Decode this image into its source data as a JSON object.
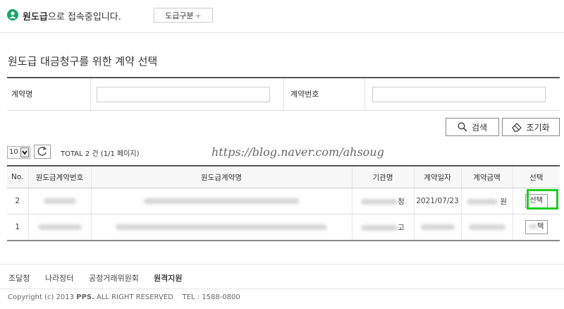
{
  "header": {
    "user_bold": "원도급",
    "status_suffix": "으로 접속중입니다.",
    "type_button": "도급구분",
    "type_button_icon": "plus-icon"
  },
  "page_title": "원도급 대금청구를 위한 계약 선택",
  "search": {
    "contract_name_label": "계약명",
    "contract_name_value": "",
    "contract_no_label": "계약번호",
    "contract_no_value": "",
    "search_button": "검색",
    "reset_button": "조기화"
  },
  "list_meta": {
    "page_size": "10",
    "total": "TOTAL 2 건 (1/1 페이지)"
  },
  "watermark": "https://blog.naver.com/ahsoug",
  "table": {
    "headers": [
      "No.",
      "원도급계약번호",
      "원도급계약명",
      "기관명",
      "계약일자",
      "계약금액",
      "선택"
    ],
    "rows": [
      {
        "no": "2",
        "agency_suffix": "청",
        "date": "2021/07/23",
        "amount_suffix": "원",
        "select": "선택"
      },
      {
        "no": "1",
        "agency_suffix": "고",
        "date": "",
        "amount_suffix": "",
        "select": "택"
      }
    ]
  },
  "footer": {
    "links": [
      "조달청",
      "나라장터",
      "공정거래위원회",
      "원격지원"
    ],
    "copyright_prefix": "Copyright (c) 2013 ",
    "copyright_brand": "PPS.",
    "copyright_suffix": " ALL RIGHT RESERVED    TEL : 1588-0800"
  },
  "colors": {
    "accent": "#1aa36a",
    "highlight": "#22cc22"
  }
}
